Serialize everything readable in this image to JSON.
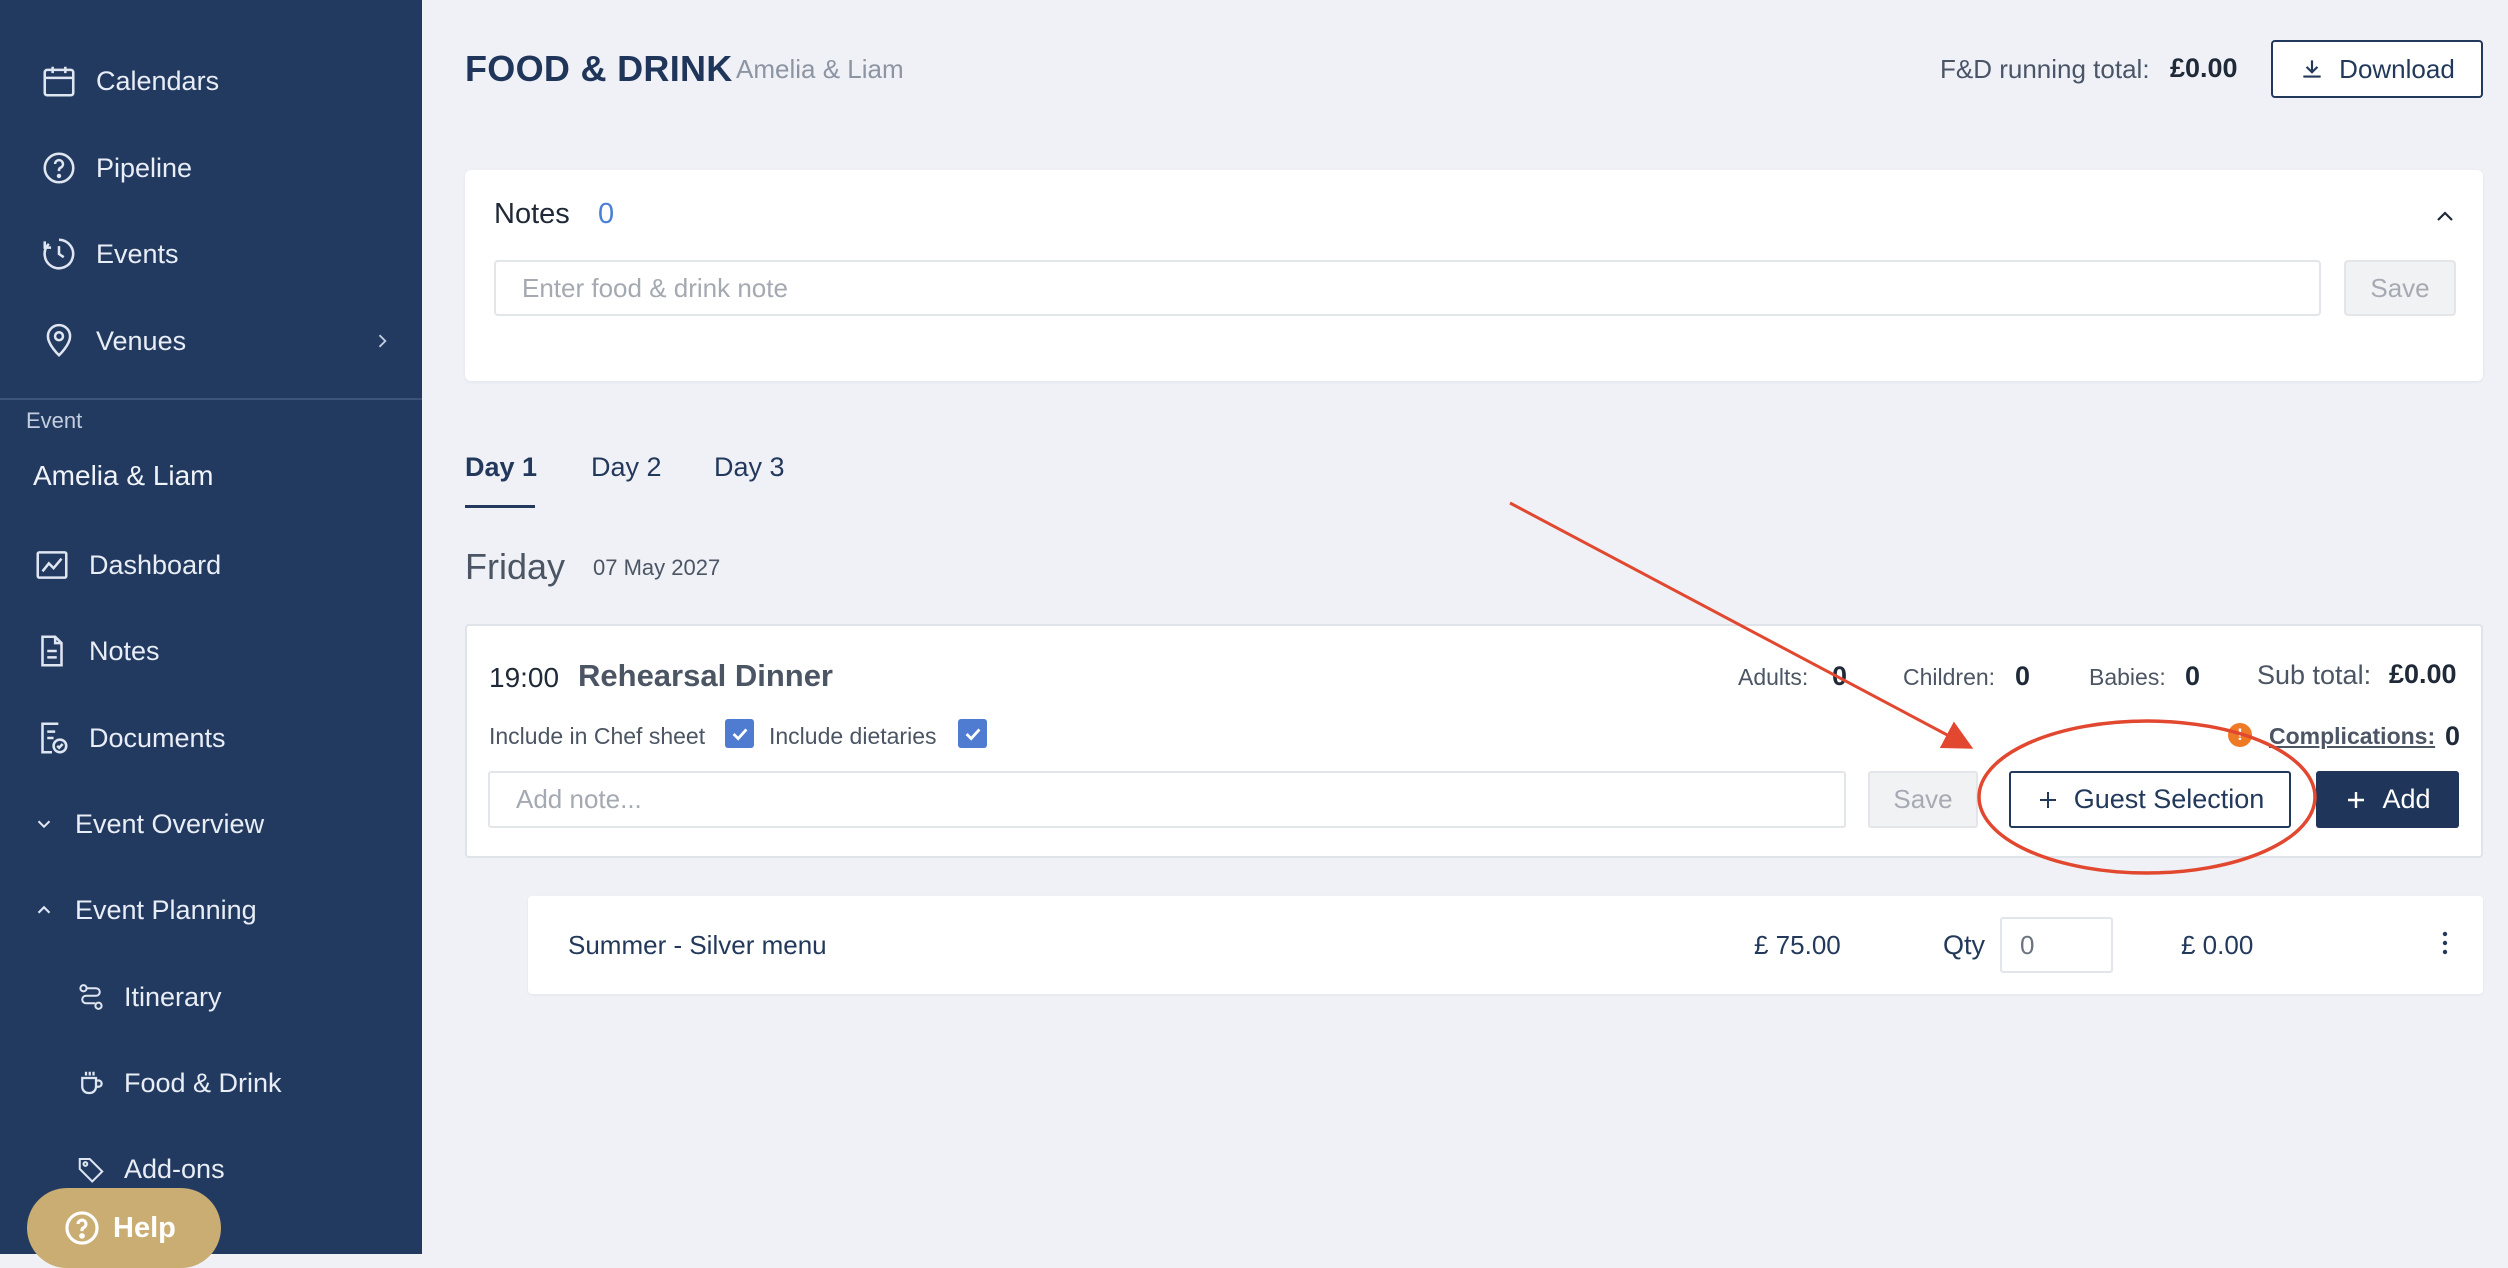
{
  "sidebar": {
    "top_items": [
      {
        "label": "Calendars",
        "icon": "calendar-icon"
      },
      {
        "label": "Pipeline",
        "icon": "question-circle-icon"
      },
      {
        "label": "Events",
        "icon": "history-icon"
      },
      {
        "label": "Venues",
        "icon": "location-pin-icon",
        "has_submenu": true
      }
    ],
    "section_label": "Event",
    "event_name": "Amelia & Liam",
    "event_items": [
      {
        "label": "Dashboard",
        "icon": "chart-line-icon"
      },
      {
        "label": "Notes",
        "icon": "document-icon"
      },
      {
        "label": "Documents",
        "icon": "document-check-icon"
      },
      {
        "label": "Event Overview",
        "icon": "chevron-down-icon"
      },
      {
        "label": "Event Planning",
        "icon": "chevron-up-icon"
      },
      {
        "label": "Itinerary",
        "icon": "route-icon"
      },
      {
        "label": "Food & Drink",
        "icon": "cup-icon",
        "active": true
      },
      {
        "label": "Add-ons",
        "icon": "tag-icon"
      }
    ],
    "help_label": "Help"
  },
  "header": {
    "title": "FOOD & DRINK",
    "subtitle": "Amelia & Liam",
    "running_total_label": "F&D running total:",
    "running_total_value": "£0.00",
    "download_label": "Download"
  },
  "notes": {
    "title": "Notes",
    "count": "0",
    "input_placeholder": "Enter food & drink note",
    "save_label": "Save"
  },
  "tabs": [
    {
      "label": "Day 1",
      "active": true
    },
    {
      "label": "Day 2"
    },
    {
      "label": "Day 3"
    }
  ],
  "day": {
    "weekday": "Friday",
    "date": "07 May 2027"
  },
  "event": {
    "time": "19:00",
    "name": "Rehearsal Dinner",
    "adults_label": "Adults:",
    "adults_value": "0",
    "children_label": "Children:",
    "children_value": "0",
    "babies_label": "Babies:",
    "babies_value": "0",
    "subtotal_label": "Sub total:",
    "subtotal_value": "£0.00",
    "include_chef_label": "Include in Chef sheet",
    "include_chef_checked": true,
    "include_dietaries_label": "Include dietaries",
    "include_dietaries_checked": true,
    "warning_glyph": "!",
    "complications_label": "Complications:",
    "complications_value": "0",
    "note_placeholder": "Add note...",
    "save_label": "Save",
    "guest_selection_label": "Guest Selection",
    "add_label": "Add"
  },
  "menu_items": [
    {
      "name": "Summer - Silver menu",
      "price": "£ 75.00",
      "qty_label": "Qty",
      "qty": "0",
      "total": "£ 0.00"
    }
  ],
  "colors": {
    "sidebar_bg": "#233a60",
    "primary": "#1f3559",
    "accent_blue": "#4f7bd0",
    "annotation_red": "#e2472f",
    "warning_orange": "#ef7a25",
    "help_gold": "#c9ad72"
  }
}
